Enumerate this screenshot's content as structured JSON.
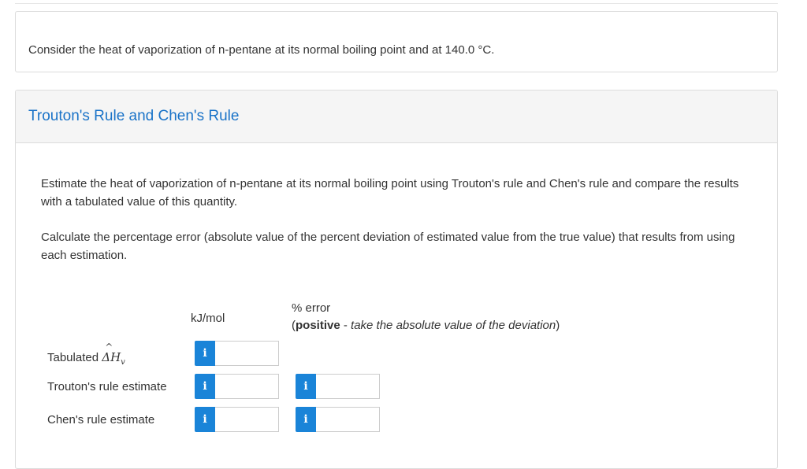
{
  "intro": {
    "text": "Consider the heat of vaporization of n-pentane at its normal boiling point and at 140.0 °C."
  },
  "section": {
    "title": "Trouton's Rule and Chen's Rule",
    "paragraph1": "Estimate the heat of vaporization of n-pentane at its normal boiling point using Trouton's rule and Chen's rule and compare the results with a tabulated value of this quantity.",
    "paragraph2": "Calculate the percentage error (absolute value of the percent deviation of estimated value from the true value) that results from using each estimation."
  },
  "table": {
    "unit_header": "kJ/mol",
    "error_header": "% error",
    "error_note_open": "(",
    "error_note_bold": "positive",
    "error_note_sep": " - ",
    "error_note_italic": "take the absolute value of the deviation",
    "error_note_close": ")",
    "rows": [
      {
        "label": "Tabulated",
        "symbol_delta": "ΔH",
        "symbol_hat": "^",
        "symbol_sub": "v",
        "kj_value": "",
        "error_value": null
      },
      {
        "label": "Trouton's rule estimate",
        "kj_value": "",
        "error_value": ""
      },
      {
        "label": "Chen's rule estimate",
        "kj_value": "",
        "error_value": ""
      }
    ],
    "info_icon_glyph": "i"
  },
  "colors": {
    "link_blue": "#1a73c8",
    "info_button_blue": "#1a84d8",
    "header_bg": "#f5f5f5"
  },
  "icons": [
    "info-icon"
  ]
}
